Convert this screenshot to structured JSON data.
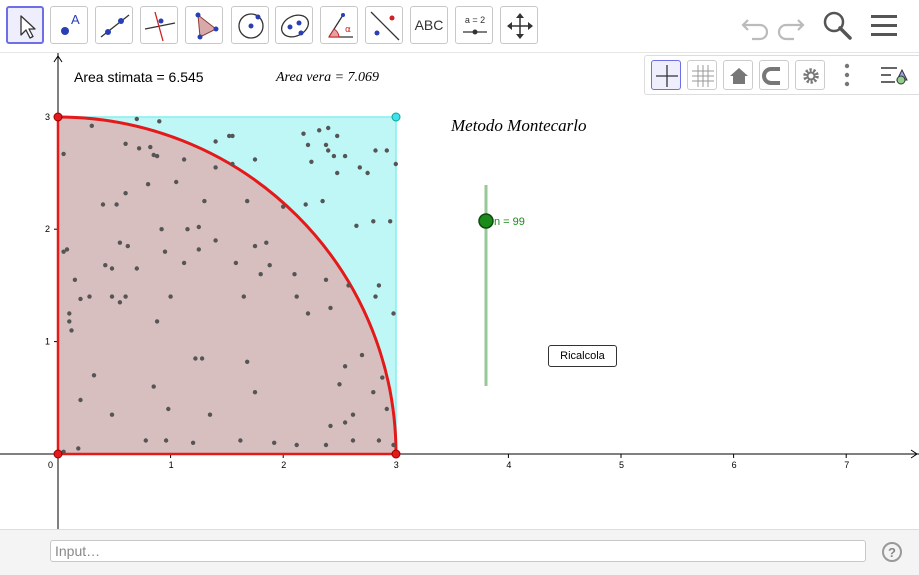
{
  "toolbar": {
    "text_tool_label": "ABC",
    "slider_tool_label": "a = 2",
    "tools": [
      "move-tool",
      "point-tool",
      "line-tool",
      "perpendicular-tool",
      "polygon-tool",
      "circle-tool",
      "conic-tool",
      "angle-tool",
      "reflect-tool",
      "text-tool",
      "slider-tool",
      "move-graphics-view-tool"
    ]
  },
  "annotations": {
    "area_estimated": "Area stimata = 6.545",
    "area_true": "Area vera = 7.069",
    "title": "Metodo Montecarlo"
  },
  "slider": {
    "label": "n = 99",
    "value": 99,
    "color": "#1a8a1a"
  },
  "button": {
    "label": "Ricalcola"
  },
  "input": {
    "placeholder": "Input…"
  },
  "help": {
    "label": "?"
  },
  "axes": {
    "x_ticks": [
      "0",
      "1",
      "2",
      "3",
      "4",
      "5",
      "6",
      "7"
    ],
    "y_ticks": [
      "1",
      "2",
      "3"
    ]
  },
  "colors": {
    "square_fill": "#bff7f7",
    "square_edge": "#80f0f0",
    "quarter_fill": "#d8bfbf",
    "arc": "#e41a1a",
    "vertex": "#e41a1a",
    "vertex_cyan": "#40e0f0",
    "dots": "#555555",
    "slider": "#1a8a1a",
    "accent": "#6e6ee6"
  },
  "points": [
    [
      0.05,
      0.02
    ],
    [
      0.18,
      0.05
    ],
    [
      0.78,
      0.12
    ],
    [
      0.96,
      0.12
    ],
    [
      1.2,
      0.1
    ],
    [
      1.62,
      0.12
    ],
    [
      1.92,
      0.1
    ],
    [
      2.12,
      0.08
    ],
    [
      2.38,
      0.08
    ],
    [
      2.62,
      0.12
    ],
    [
      2.85,
      0.12
    ],
    [
      2.98,
      0.08
    ],
    [
      0.48,
      0.35
    ],
    [
      0.85,
      0.6
    ],
    [
      0.98,
      0.4
    ],
    [
      1.35,
      0.35
    ],
    [
      1.75,
      0.55
    ],
    [
      2.42,
      0.25
    ],
    [
      2.55,
      0.28
    ],
    [
      2.62,
      0.35
    ],
    [
      2.8,
      0.55
    ],
    [
      2.92,
      0.4
    ],
    [
      0.2,
      0.48
    ],
    [
      0.32,
      0.7
    ],
    [
      1.22,
      0.85
    ],
    [
      1.28,
      0.85
    ],
    [
      1.68,
      0.82
    ],
    [
      2.5,
      0.62
    ],
    [
      2.55,
      0.78
    ],
    [
      2.7,
      0.88
    ],
    [
      2.88,
      0.68
    ],
    [
      0.1,
      1.18
    ],
    [
      0.1,
      1.25
    ],
    [
      0.12,
      1.1
    ],
    [
      0.2,
      1.38
    ],
    [
      0.28,
      1.4
    ],
    [
      0.48,
      1.4
    ],
    [
      0.55,
      1.35
    ],
    [
      0.6,
      1.4
    ],
    [
      0.88,
      1.18
    ],
    [
      1.0,
      1.4
    ],
    [
      1.65,
      1.4
    ],
    [
      2.12,
      1.4
    ],
    [
      2.22,
      1.25
    ],
    [
      2.42,
      1.3
    ],
    [
      2.58,
      1.5
    ],
    [
      2.82,
      1.4
    ],
    [
      2.85,
      1.5
    ],
    [
      2.98,
      1.25
    ],
    [
      0.15,
      1.55
    ],
    [
      0.42,
      1.68
    ],
    [
      0.48,
      1.65
    ],
    [
      0.62,
      1.85
    ],
    [
      0.7,
      1.65
    ],
    [
      1.12,
      1.7
    ],
    [
      1.58,
      1.7
    ],
    [
      1.8,
      1.6
    ],
    [
      1.88,
      1.68
    ],
    [
      2.1,
      1.6
    ],
    [
      2.38,
      1.55
    ],
    [
      0.05,
      1.8
    ],
    [
      0.08,
      1.82
    ],
    [
      0.55,
      1.88
    ],
    [
      0.95,
      1.8
    ],
    [
      1.25,
      1.82
    ],
    [
      1.4,
      1.9
    ],
    [
      1.75,
      1.85
    ],
    [
      1.85,
      1.88
    ],
    [
      0.92,
      2.0
    ],
    [
      1.15,
      2.0
    ],
    [
      1.25,
      2.02
    ],
    [
      2.65,
      2.03
    ],
    [
      2.8,
      2.07
    ],
    [
      2.95,
      2.07
    ],
    [
      0.4,
      2.22
    ],
    [
      0.52,
      2.22
    ],
    [
      0.6,
      2.32
    ],
    [
      1.3,
      2.25
    ],
    [
      1.68,
      2.25
    ],
    [
      2.0,
      2.2
    ],
    [
      2.2,
      2.22
    ],
    [
      2.35,
      2.25
    ],
    [
      2.48,
      2.5
    ],
    [
      0.8,
      2.4
    ],
    [
      1.05,
      2.42
    ],
    [
      1.4,
      2.55
    ],
    [
      1.55,
      2.58
    ],
    [
      1.75,
      2.62
    ],
    [
      2.25,
      2.6
    ],
    [
      2.45,
      2.65
    ],
    [
      2.68,
      2.55
    ],
    [
      2.75,
      2.5
    ],
    [
      2.82,
      2.7
    ],
    [
      2.92,
      2.7
    ],
    [
      3.0,
      2.58
    ],
    [
      0.05,
      2.67
    ],
    [
      0.6,
      2.76
    ],
    [
      0.72,
      2.72
    ],
    [
      0.82,
      2.73
    ],
    [
      0.88,
      2.65
    ],
    [
      0.85,
      2.66
    ],
    [
      1.12,
      2.62
    ],
    [
      1.4,
      2.78
    ],
    [
      1.52,
      2.83
    ],
    [
      1.55,
      2.83
    ],
    [
      2.18,
      2.85
    ],
    [
      2.22,
      2.75
    ],
    [
      2.38,
      2.75
    ],
    [
      2.4,
      2.9
    ],
    [
      2.48,
      2.83
    ],
    [
      2.55,
      2.65
    ],
    [
      0.3,
      2.92
    ],
    [
      0.7,
      2.98
    ],
    [
      0.9,
      2.96
    ],
    [
      2.32,
      2.88
    ],
    [
      2.4,
      2.7
    ]
  ]
}
